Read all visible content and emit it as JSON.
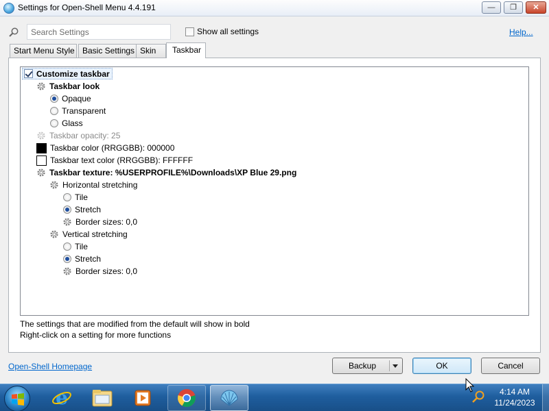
{
  "window": {
    "title": "Settings for Open-Shell Menu 4.4.191",
    "controls": {
      "minimize": "minimize",
      "maximize": "maximize",
      "close": "close"
    }
  },
  "toolbar": {
    "search_placeholder": "Search Settings",
    "show_all_label": "Show all settings",
    "show_all_checked": false,
    "help_link": "Help..."
  },
  "tabs": [
    {
      "label": "Start Menu Style",
      "active": false
    },
    {
      "label": "Basic Settings",
      "active": false
    },
    {
      "label": "Skin",
      "active": false
    },
    {
      "label": "Taskbar",
      "active": true
    }
  ],
  "tree": {
    "customize_taskbar": {
      "label": "Customize taskbar",
      "checked": true
    },
    "taskbar_look": "Taskbar look",
    "look_options": [
      {
        "label": "Opaque",
        "selected": true
      },
      {
        "label": "Transparent",
        "selected": false
      },
      {
        "label": "Glass",
        "selected": false
      }
    ],
    "taskbar_opacity": "Taskbar opacity: 25",
    "taskbar_color": {
      "label": "Taskbar color (RRGGBB): 000000",
      "swatch": "#000000"
    },
    "taskbar_text_color": {
      "label": "Taskbar text color (RRGGBB): FFFFFF",
      "swatch": "#FFFFFF"
    },
    "taskbar_texture": "Taskbar texture: %USERPROFILE%\\Downloads\\XP Blue 29.png",
    "horizontal": {
      "label": "Horizontal stretching",
      "options": [
        {
          "label": "Tile",
          "selected": false
        },
        {
          "label": "Stretch",
          "selected": true
        }
      ],
      "border_sizes": "Border sizes: 0,0"
    },
    "vertical": {
      "label": "Vertical stretching",
      "options": [
        {
          "label": "Tile",
          "selected": false
        },
        {
          "label": "Stretch",
          "selected": true
        }
      ],
      "border_sizes": "Border sizes: 0,0"
    }
  },
  "notes": {
    "line1": "The settings that are modified from the default will show in bold",
    "line2": "Right-click on a setting for more functions"
  },
  "footer": {
    "homepage_link": "Open-Shell Homepage",
    "backup_label": "Backup",
    "ok_label": "OK",
    "cancel_label": "Cancel"
  },
  "taskbar": {
    "apps": [
      {
        "icon": "internet-explorer-icon"
      },
      {
        "icon": "file-explorer-icon"
      },
      {
        "icon": "media-player-icon"
      },
      {
        "icon": "chrome-icon"
      },
      {
        "icon": "open-shell-icon"
      }
    ],
    "time": "4:14 AM",
    "date": "11/24/2023"
  },
  "colors": {
    "link": "#0066cc",
    "taskbar_bg": "#1f5e9e",
    "selection_bg": "#eaf3fd"
  }
}
